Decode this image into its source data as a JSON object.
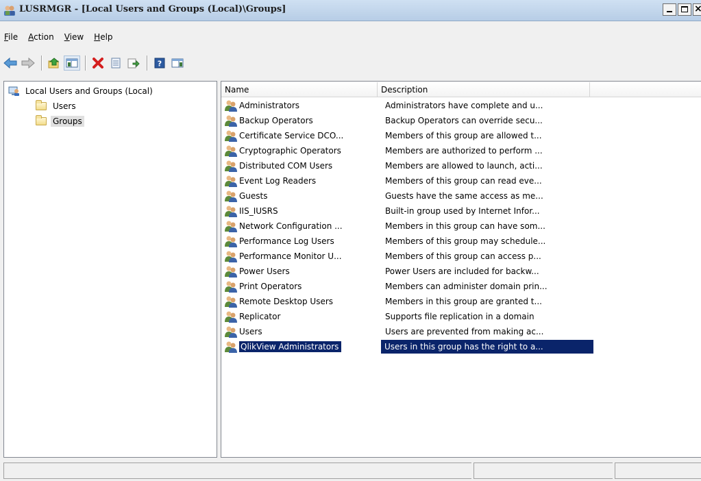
{
  "window": {
    "title": "LUSRMGR - [Local Users and Groups (Local)\\Groups]",
    "app_icon": "users-group-icon",
    "caption_buttons": [
      "minimize",
      "maximize",
      "close"
    ]
  },
  "menu": {
    "file": {
      "underline": "F",
      "rest": "ile"
    },
    "action": {
      "underline": "A",
      "rest": "ction"
    },
    "view": {
      "underline": "V",
      "rest": "iew"
    },
    "help": {
      "underline": "H",
      "rest": "elp"
    }
  },
  "toolbar": {
    "buttons": [
      "back-arrow-icon",
      "forward-arrow-icon",
      "up-folder-icon",
      "show-hide-console-tree-icon",
      "delete-icon",
      "properties-icon",
      "export-list-icon",
      "help-icon",
      "action-pane-icon"
    ],
    "pressed": "show-hide-console-tree-icon"
  },
  "tree": {
    "root": "Local Users and Groups (Local)",
    "children": [
      "Users",
      "Groups"
    ],
    "selected": "Groups"
  },
  "list": {
    "columns": [
      "Name",
      "Description",
      ""
    ],
    "rows": [
      {
        "name": "Administrators",
        "description": "Administrators have complete and u..."
      },
      {
        "name": "Backup Operators",
        "description": "Backup Operators can override secu..."
      },
      {
        "name": "Certificate Service DCO...",
        "description": "Members of this group are allowed t..."
      },
      {
        "name": "Cryptographic Operators",
        "description": "Members are authorized to perform ..."
      },
      {
        "name": "Distributed COM Users",
        "description": "Members are allowed to launch, acti..."
      },
      {
        "name": "Event Log Readers",
        "description": "Members of this group can read eve..."
      },
      {
        "name": "Guests",
        "description": "Guests have the same access as me..."
      },
      {
        "name": "IIS_IUSRS",
        "description": "Built-in group used by Internet Infor..."
      },
      {
        "name": "Network Configuration ...",
        "description": "Members in this group can have som..."
      },
      {
        "name": "Performance Log Users",
        "description": "Members of this group may schedule..."
      },
      {
        "name": "Performance Monitor U...",
        "description": "Members of this group can access p..."
      },
      {
        "name": "Power Users",
        "description": "Power Users are included for backw..."
      },
      {
        "name": "Print Operators",
        "description": "Members can administer domain prin..."
      },
      {
        "name": "Remote Desktop Users",
        "description": "Members in this group are granted t..."
      },
      {
        "name": "Replicator",
        "description": "Supports file replication in a domain"
      },
      {
        "name": "Users",
        "description": "Users are prevented from making ac..."
      },
      {
        "name": "QlikView Administrators",
        "description": "Users in this group has the right to a..."
      }
    ],
    "selected_row": "QlikView Administrators"
  },
  "colors": {
    "selection": "#0a246a",
    "titlebar": "#b7cde6"
  }
}
